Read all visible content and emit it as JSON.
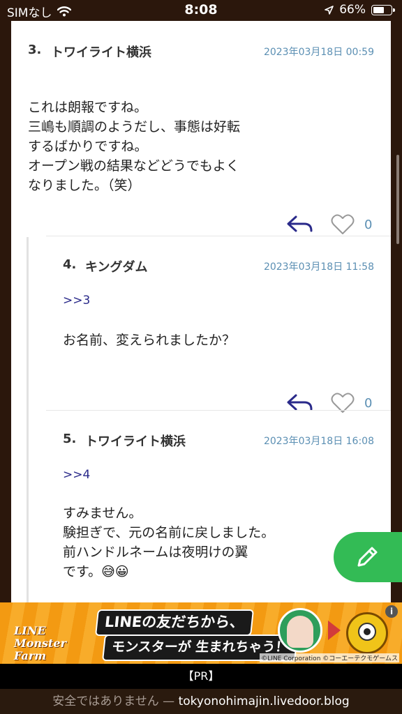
{
  "status_bar": {
    "carrier": "SIMなし",
    "time": "8:08",
    "battery_percent": "66%",
    "battery_level": 0.66
  },
  "comments": [
    {
      "number": "3.",
      "name": "トワイライト横浜",
      "date": "2023年03月18日 00:59",
      "anchor": "",
      "body_lines": [
        "これは朗報ですね。",
        "三嶋も順調のようだし、事態は好転",
        "するばかりですね。",
        "オープン戦の結果などどうでもよく",
        "なりました。（笑）"
      ],
      "likes": "0"
    },
    {
      "number": "4.",
      "name": "キングダム",
      "date": "2023年03月18日 11:58",
      "anchor": ">>3",
      "body_lines": [
        "お名前、変えられましたか？"
      ],
      "likes": "0"
    },
    {
      "number": "5.",
      "name": "トワイライト横浜",
      "date": "2023年03月18日 16:08",
      "anchor": ">>4",
      "body_lines": [
        "すみません。",
        "験担ぎで、元の名前に戻しました。",
        "前ハンドルネームは夜明けの翼",
        "です。😅😀"
      ]
    }
  ],
  "ad": {
    "logo_line1": "LINE",
    "logo_line2": "Monster",
    "logo_line3": "Farm",
    "headline1": "LINEの友だちから、",
    "headline2": "モンスターが 生まれちゃう！",
    "credit": "©LINE Corporation ©コーエーテクモゲームス",
    "info": "i"
  },
  "pr_label": "【PR】",
  "url_bar": {
    "insecure_text": "安全ではありません —",
    "domain": "tokyonohimajin.livedoor.blog"
  },
  "colors": {
    "accent_green": "#33bb55",
    "date_blue": "#5b8fb3",
    "anchor_navy": "#2a2a8a",
    "browser_chrome": "#2b170c"
  },
  "icons": {
    "reply": "reply-arrow-icon",
    "like": "heart-icon",
    "compose": "pencil-icon",
    "wifi": "wifi-icon",
    "location": "location-arrow-icon",
    "battery": "battery-icon"
  }
}
